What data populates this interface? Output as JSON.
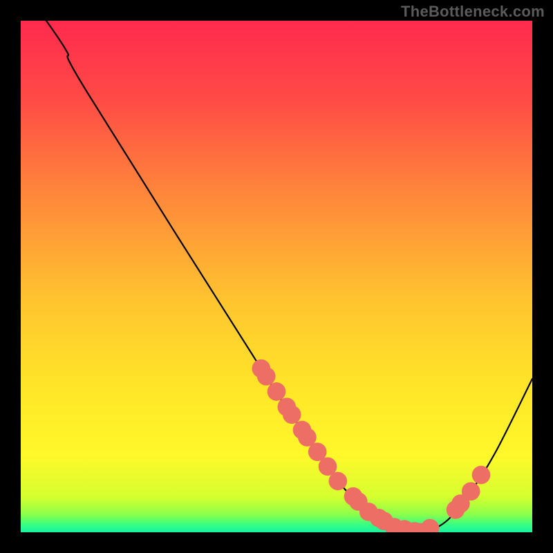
{
  "watermark": "TheBottleneck.com",
  "chart_data": {
    "type": "line",
    "title": "",
    "xlabel": "",
    "ylabel": "",
    "xlim": [
      0,
      100
    ],
    "ylim": [
      0,
      100
    ],
    "curve": [
      {
        "x": 5,
        "y": 100
      },
      {
        "x": 9,
        "y": 94
      },
      {
        "x": 13,
        "y": 86
      },
      {
        "x": 47,
        "y": 32
      },
      {
        "x": 55,
        "y": 20
      },
      {
        "x": 62,
        "y": 10
      },
      {
        "x": 68,
        "y": 4
      },
      {
        "x": 73,
        "y": 1
      },
      {
        "x": 78,
        "y": 0
      },
      {
        "x": 83,
        "y": 2
      },
      {
        "x": 88,
        "y": 8
      },
      {
        "x": 93,
        "y": 16
      },
      {
        "x": 100,
        "y": 30
      }
    ],
    "scatter_on_curve_x": [
      47,
      48,
      50,
      52,
      53,
      55,
      56,
      58,
      60,
      62,
      65,
      66,
      68,
      70,
      71,
      73,
      75,
      77,
      78,
      80,
      85,
      86,
      88,
      90
    ],
    "marker_radius_domain": 1.8,
    "marker_color": "#ec6e64",
    "curve_color": "#000000",
    "curve_width": 2.2,
    "gradient_stops": [
      {
        "offset": 0.0,
        "color": "#ff2a4e"
      },
      {
        "offset": 0.15,
        "color": "#ff4a46"
      },
      {
        "offset": 0.35,
        "color": "#ff8a3a"
      },
      {
        "offset": 0.55,
        "color": "#ffc52f"
      },
      {
        "offset": 0.72,
        "color": "#ffe628"
      },
      {
        "offset": 0.85,
        "color": "#fff82a"
      },
      {
        "offset": 0.93,
        "color": "#d6ff2f"
      },
      {
        "offset": 0.965,
        "color": "#8dff4a"
      },
      {
        "offset": 0.985,
        "color": "#38ff82"
      },
      {
        "offset": 1.0,
        "color": "#17f3a1"
      }
    ]
  }
}
